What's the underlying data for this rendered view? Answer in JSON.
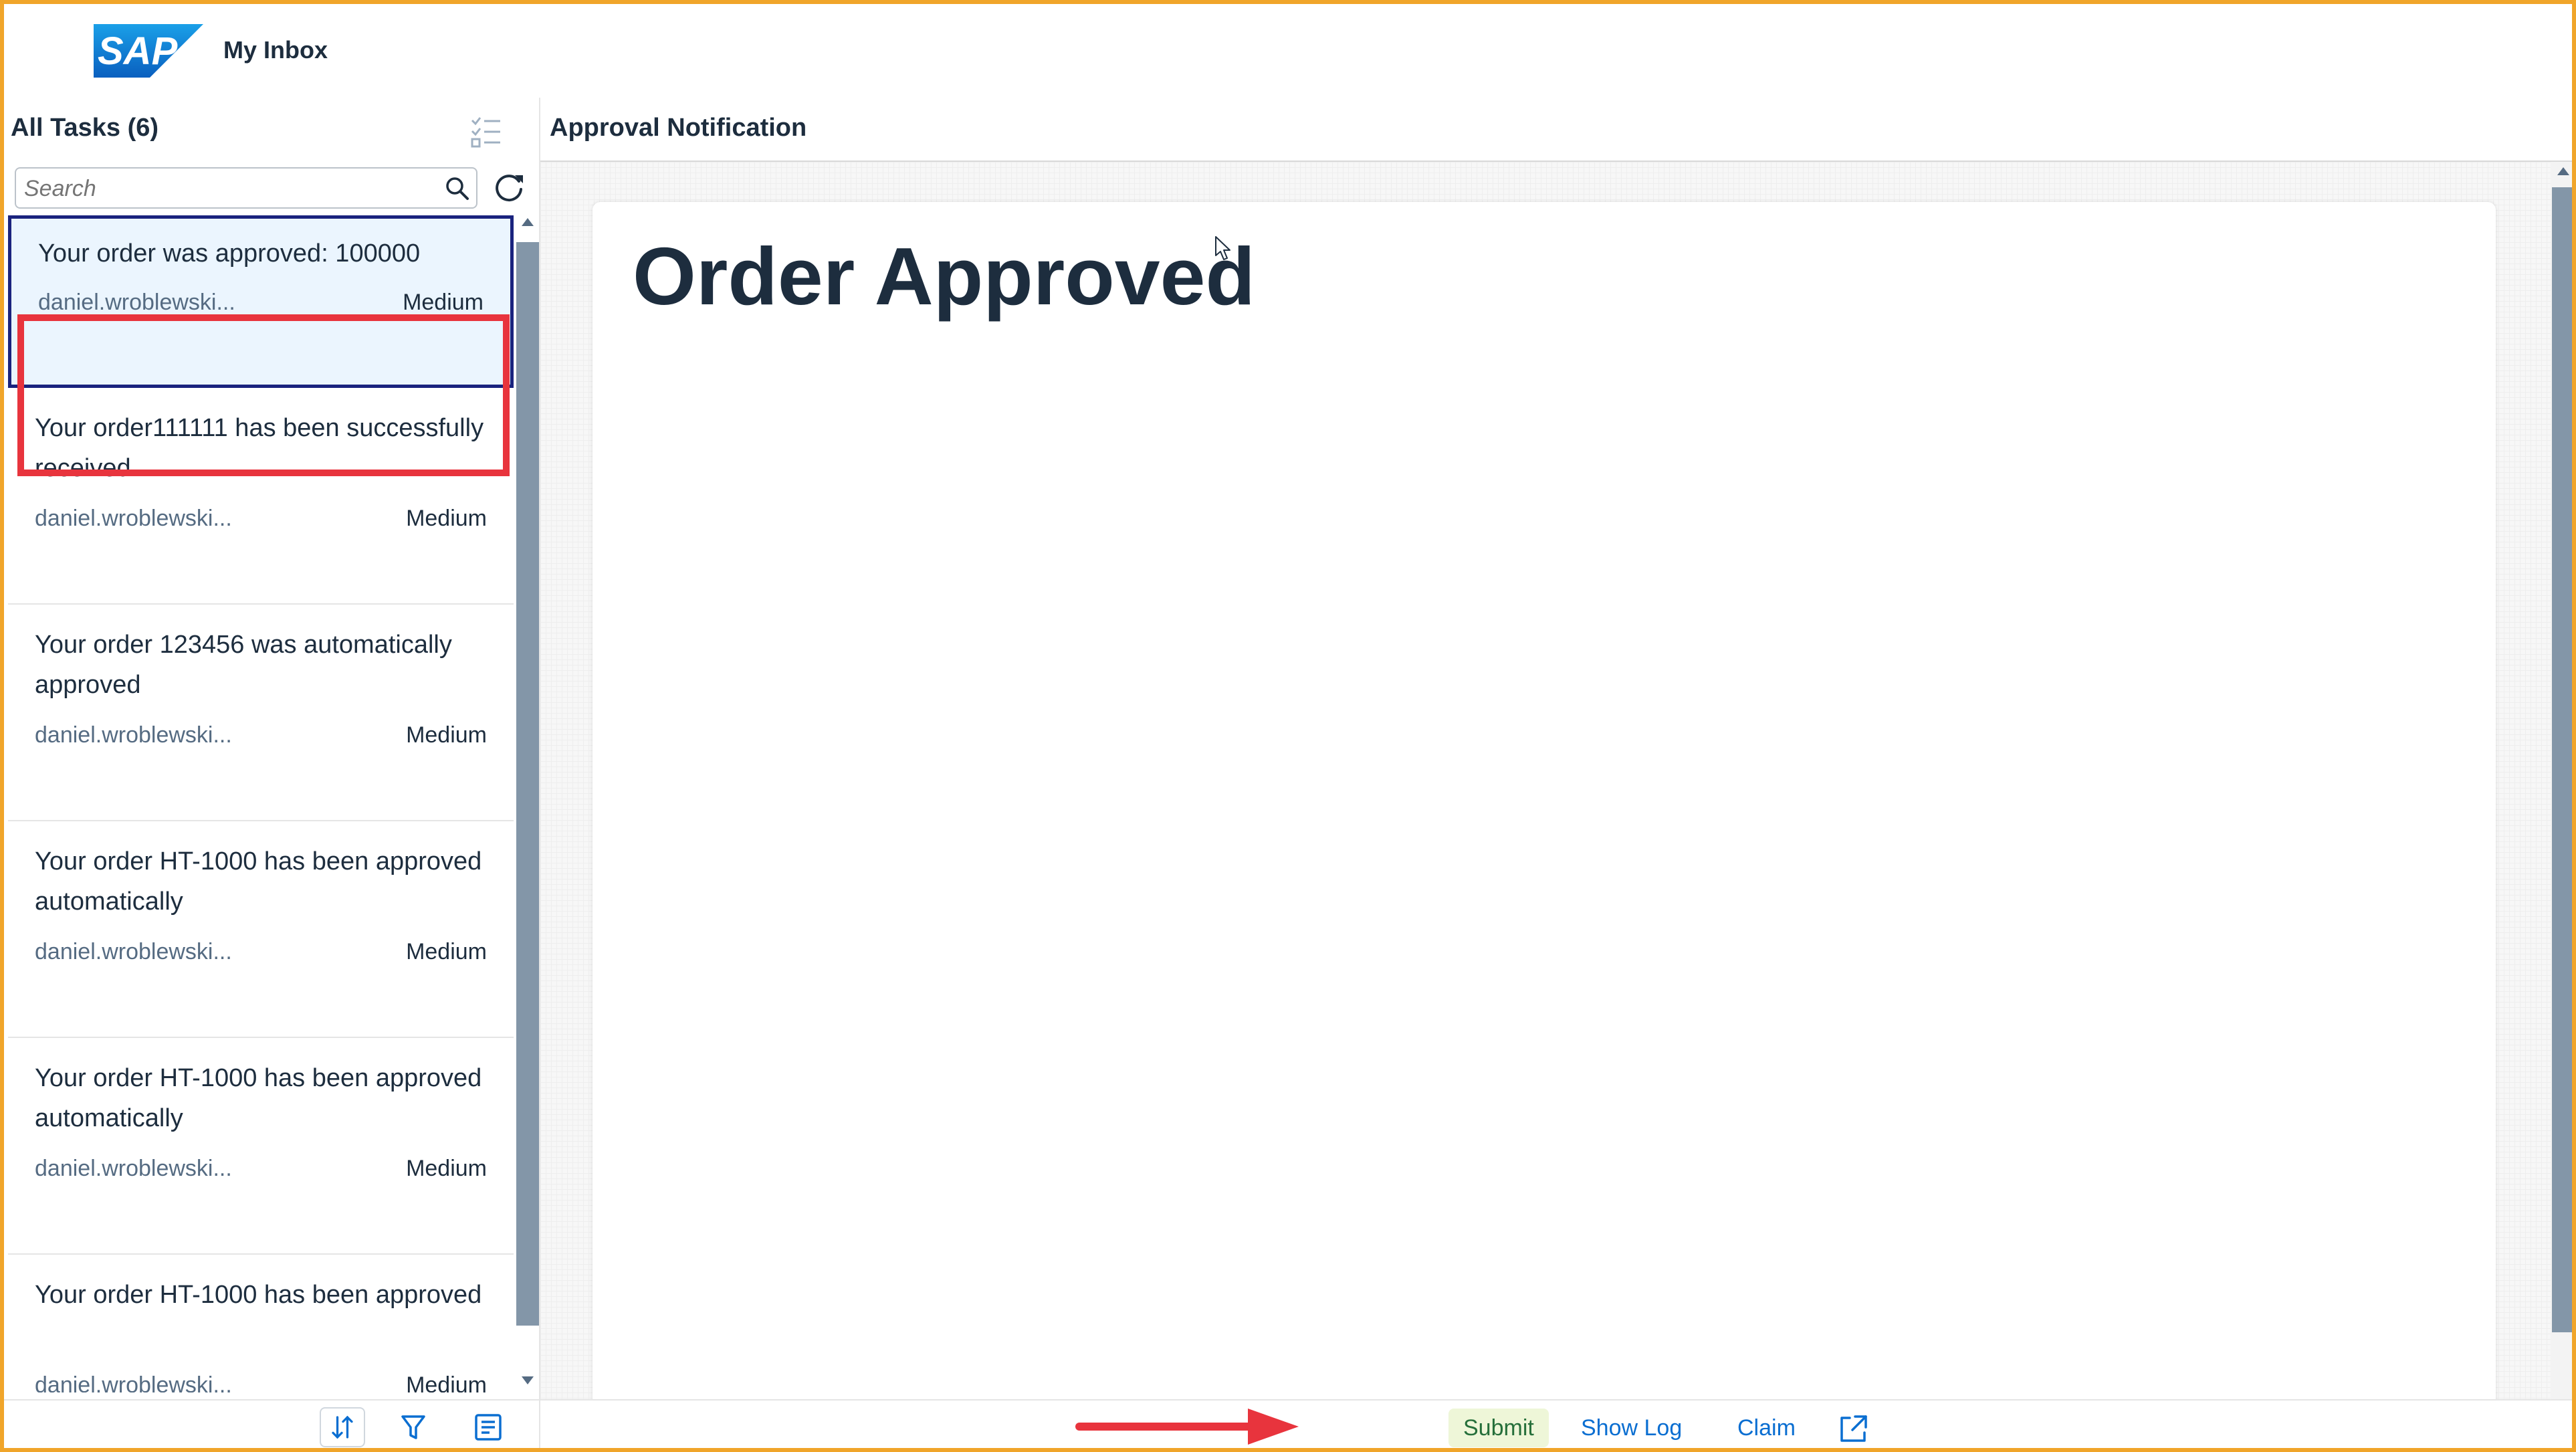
{
  "shell": {
    "logo_text": "SAP",
    "app_title": "My Inbox"
  },
  "master": {
    "title": "All Tasks (6)",
    "search_placeholder": "Search",
    "tasks": [
      {
        "title": "Your order was approved: 100000",
        "creator": "daniel.wroblewski...",
        "priority": "Medium"
      },
      {
        "title": "Your order111111 has been successfully received",
        "creator": "daniel.wroblewski...",
        "priority": "Medium"
      },
      {
        "title": "Your order 123456 was automatically approved",
        "creator": "daniel.wroblewski...",
        "priority": "Medium"
      },
      {
        "title": "Your order HT-1000 has been approved automatically",
        "creator": "daniel.wroblewski...",
        "priority": "Medium"
      },
      {
        "title": "Your order HT-1000 has been approved automatically",
        "creator": "daniel.wroblewski...",
        "priority": "Medium"
      },
      {
        "title": "Your order HT-1000 has been approved",
        "creator": "daniel.wroblewski...",
        "priority": "Medium"
      }
    ]
  },
  "detail": {
    "title": "Approval Notification",
    "heading": "Order Approved"
  },
  "footer": {
    "submit_label": "Submit",
    "show_log_label": "Show Log",
    "claim_label": "Claim"
  },
  "icons": {
    "multiselect": "multiselect-icon",
    "search": "search-icon",
    "refresh": "refresh-icon",
    "sort": "sort-icon",
    "filter": "filter-icon",
    "group": "group-icon",
    "open_new": "open-in-new-icon",
    "cursor": "mouse-cursor-icon"
  },
  "colors": {
    "frame_border": "#f0a52a",
    "accent": "#0a6ed1",
    "highlight": "#e8343d",
    "selected_bg": "#ebf5fe",
    "submit_bg": "#eef6d8"
  }
}
